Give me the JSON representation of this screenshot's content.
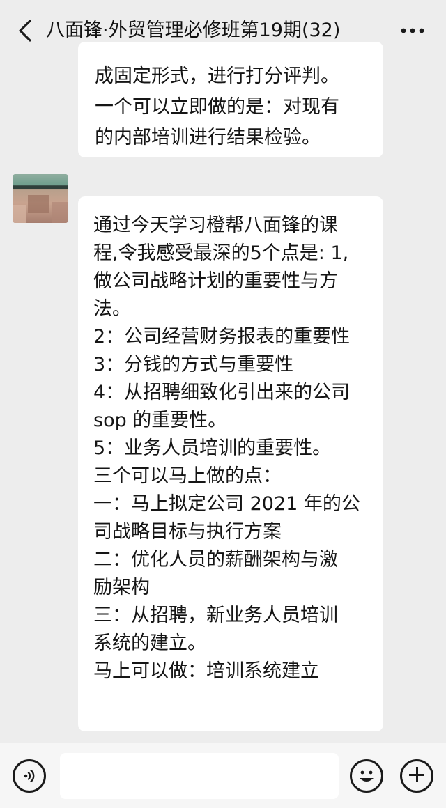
{
  "header": {
    "title": "八面锋·外贸管理必修班第19期(32)",
    "back_icon": "chevron-left-icon",
    "more_icon": "more-dots-icon"
  },
  "messages": [
    {
      "lines": [
        "成固定形式，进行打分评判。",
        " 一个可以立即做的是：对现有",
        "的内部培训进行结果检验。"
      ]
    },
    {
      "sender": "",
      "lines": [
        "通过今天学习橙帮八面锋的课",
        "程,令我感受最深的5个点是: 1,",
        "做公司战略计划的重要性与方",
        "法。",
        "2：公司经营财务报表的重要性",
        "3：分钱的方式与重要性",
        "4：从招聘细致化引出来的公司",
        "sop 的重要性。",
        "5：业务人员培训的重要性。",
        "三个可以马上做的点：",
        "一：马上拟定公司 2021 年的公",
        "司战略目标与执行方案",
        "二：优化人员的薪酬架构与激",
        "励架构",
        "三：从招聘，新业务人员培训",
        "系统的建立。",
        "马上可以做：培训系统建立"
      ]
    }
  ],
  "input_bar": {
    "voice_icon": "voice-icon",
    "input_value": "",
    "emoji_icon": "emoji-icon",
    "plus_icon": "plus-icon"
  },
  "colors": {
    "background": "#ededed",
    "bubble": "#ffffff",
    "input_bar": "#f6f6f6"
  }
}
